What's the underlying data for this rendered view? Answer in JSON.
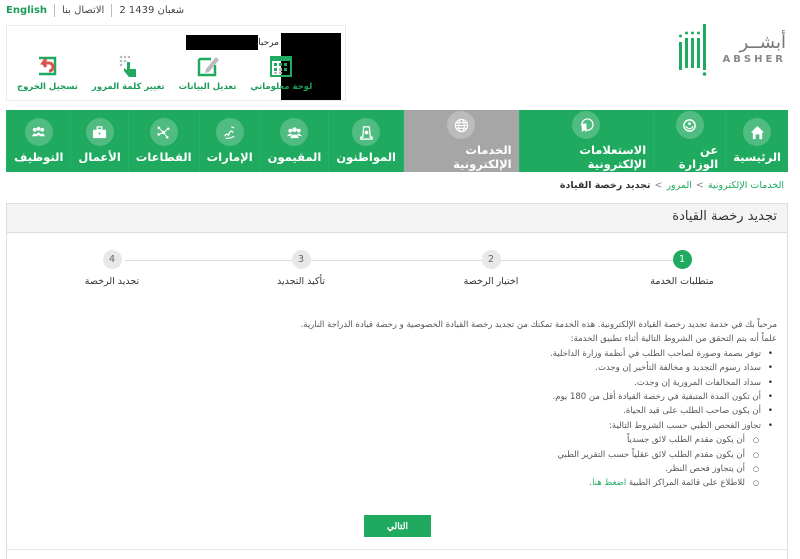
{
  "topbar": {
    "language_link": "English",
    "contact_link": "الاتصال بنا",
    "hijri_date": "2 شعبان 1439"
  },
  "user_panel": {
    "welcome_label": "مرحبا",
    "actions": [
      {
        "label": "لوحة معلوماتي",
        "icon": "dashboard-calendar-icon"
      },
      {
        "label": "تعديل البيانات",
        "icon": "edit-data-icon"
      },
      {
        "label": "تغيير كلمة المرور",
        "icon": "change-password-icon"
      },
      {
        "label": "تسجيل الخروج",
        "icon": "logout-icon"
      }
    ]
  },
  "logo": {
    "arabic": "أبشــر",
    "english": "ABSHER"
  },
  "nav": {
    "items": [
      {
        "label": "الرئيسية",
        "icon": "home-icon",
        "active": false
      },
      {
        "label": "عن الوزارة",
        "icon": "ministry-emblem-icon",
        "active": false
      },
      {
        "label": "الاستعلامات الإلكترونية",
        "icon": "e-inquiries-icon",
        "active": false
      },
      {
        "label": "الخدمات الإلكترونية",
        "icon": "globe-icon",
        "active": true
      },
      {
        "label": "المواطنون",
        "icon": "citizen-icon",
        "active": false
      },
      {
        "label": "المقيمون",
        "icon": "residents-group-icon",
        "active": false
      },
      {
        "label": "الإمارات",
        "icon": "calligraphy-icon",
        "active": false
      },
      {
        "label": "القطاعات",
        "icon": "network-icon",
        "active": false
      },
      {
        "label": "الأعمال",
        "icon": "briefcase-icon",
        "active": false
      },
      {
        "label": "التوظيف",
        "icon": "team-icon",
        "active": false
      }
    ]
  },
  "breadcrumb": {
    "items": [
      "الخدمات الإلكترونية",
      "المرور"
    ],
    "separator": ">",
    "current": "تجديد رخصة القيادة"
  },
  "page": {
    "title": "تجديد رخصة القيادة"
  },
  "stepper": {
    "steps": [
      {
        "number": "1",
        "label": "متطلبات الخدمة",
        "active": true
      },
      {
        "number": "2",
        "label": "اختيار الرخصة",
        "active": false
      },
      {
        "number": "3",
        "label": "تأكيد التجديد",
        "active": false
      },
      {
        "number": "4",
        "label": "تجديد الرخصة",
        "active": false
      }
    ]
  },
  "content": {
    "intro": "مرحباً بك في خدمة تجديد رخصة القيادة الإلكترونية. هذه الخدمة تمكنك من تجديد رخصة القيادة الخصوصية و رخصة قيادة الدراجة النارية.",
    "conditions_intro": "علماً أنه يتم التحقق من الشروط التالية أثناء تطبيق الخدمة:",
    "conditions": [
      "توفر بصمة وصورة لصاحب الطلب في أنظمة وزارة الداخلية.",
      "سداد رسوم التجديد و مخالفة التأخير إن وجدت.",
      "سداد المخالفات المرورية إن وجدت.",
      "أن تكون المدة المتبقية في رخصة القيادة أقل من 180 يوم.",
      "أن يكون صاحب الطلب على قيد الحياة.",
      "تجاوز الفحص الطبي حسب الشروط التالية:"
    ],
    "medical_conditions": [
      "أن يكون مقدم الطلب لائق جسدياً",
      "أن يكون مقدم الطلب لائق عقلياً حسب التقرير الطبي",
      "أن يتجاوز فحص النظر."
    ],
    "medical_centers_text": "للاطلاع على قائمة المراكز الطبية",
    "medical_centers_link": "اضغط هنا",
    "medical_centers_end": "."
  },
  "buttons": {
    "next": "التالي"
  },
  "colors": {
    "brand_green": "#1faa5f",
    "active_tab_gray": "#a6a6a6",
    "logout_red": "#d9534f"
  }
}
